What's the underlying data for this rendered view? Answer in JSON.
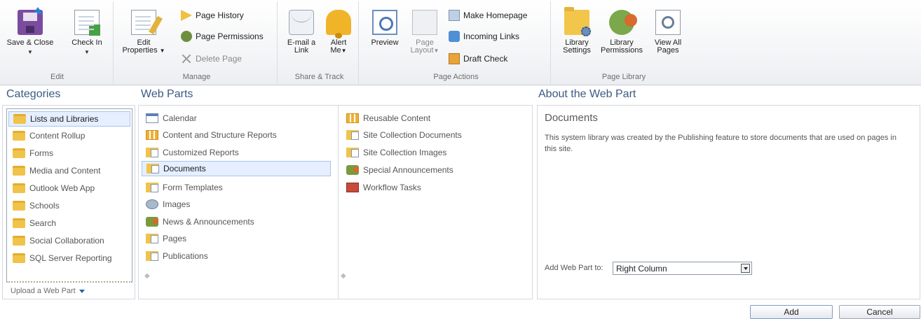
{
  "ribbon": {
    "groups": {
      "edit": "Edit",
      "manage": "Manage",
      "share_track": "Share & Track",
      "page_actions": "Page Actions",
      "page_library": "Page Library"
    },
    "buttons": {
      "save_close": "Save & Close",
      "check_in": "Check In",
      "edit_properties_line1": "Edit",
      "edit_properties_line2": "Properties",
      "page_history": "Page History",
      "page_permissions": "Page Permissions",
      "delete_page": "Delete Page",
      "email_link_line1": "E-mail a",
      "email_link_line2": "Link",
      "alert_me_line1": "Alert",
      "alert_me_line2": "Me",
      "preview": "Preview",
      "page_layout_line1": "Page",
      "page_layout_line2": "Layout",
      "make_homepage": "Make Homepage",
      "incoming_links": "Incoming Links",
      "draft_check": "Draft Check",
      "library_settings_line1": "Library",
      "library_settings_line2": "Settings",
      "library_permissions_line1": "Library",
      "library_permissions_line2": "Permissions",
      "view_all_pages_line1": "View All",
      "view_all_pages_line2": "Pages"
    }
  },
  "sections": {
    "categories": "Categories",
    "web_parts": "Web Parts",
    "about": "About the Web Part"
  },
  "categories": [
    "Lists and Libraries",
    "Content Rollup",
    "Forms",
    "Media and Content",
    "Outlook Web App",
    "Schools",
    "Search",
    "Social Collaboration",
    "SQL Server Reporting"
  ],
  "upload_link": "Upload a Web Part",
  "web_parts_col1": [
    "Calendar",
    "Content and Structure Reports",
    "Customized Reports",
    "Documents",
    "Form Templates",
    "Images",
    "News & Announcements",
    "Pages",
    "Publications"
  ],
  "web_parts_col2": [
    "Reusable Content",
    "Site Collection Documents",
    "Site Collection Images",
    "Special Announcements",
    "Workflow Tasks"
  ],
  "about": {
    "title": "Documents",
    "description": "This system library was created by the Publishing feature to store documents that are used on pages in this site.",
    "add_to_label": "Add Web Part to:",
    "add_to_value": "Right Column"
  },
  "buttons": {
    "add": "Add",
    "cancel": "Cancel"
  }
}
